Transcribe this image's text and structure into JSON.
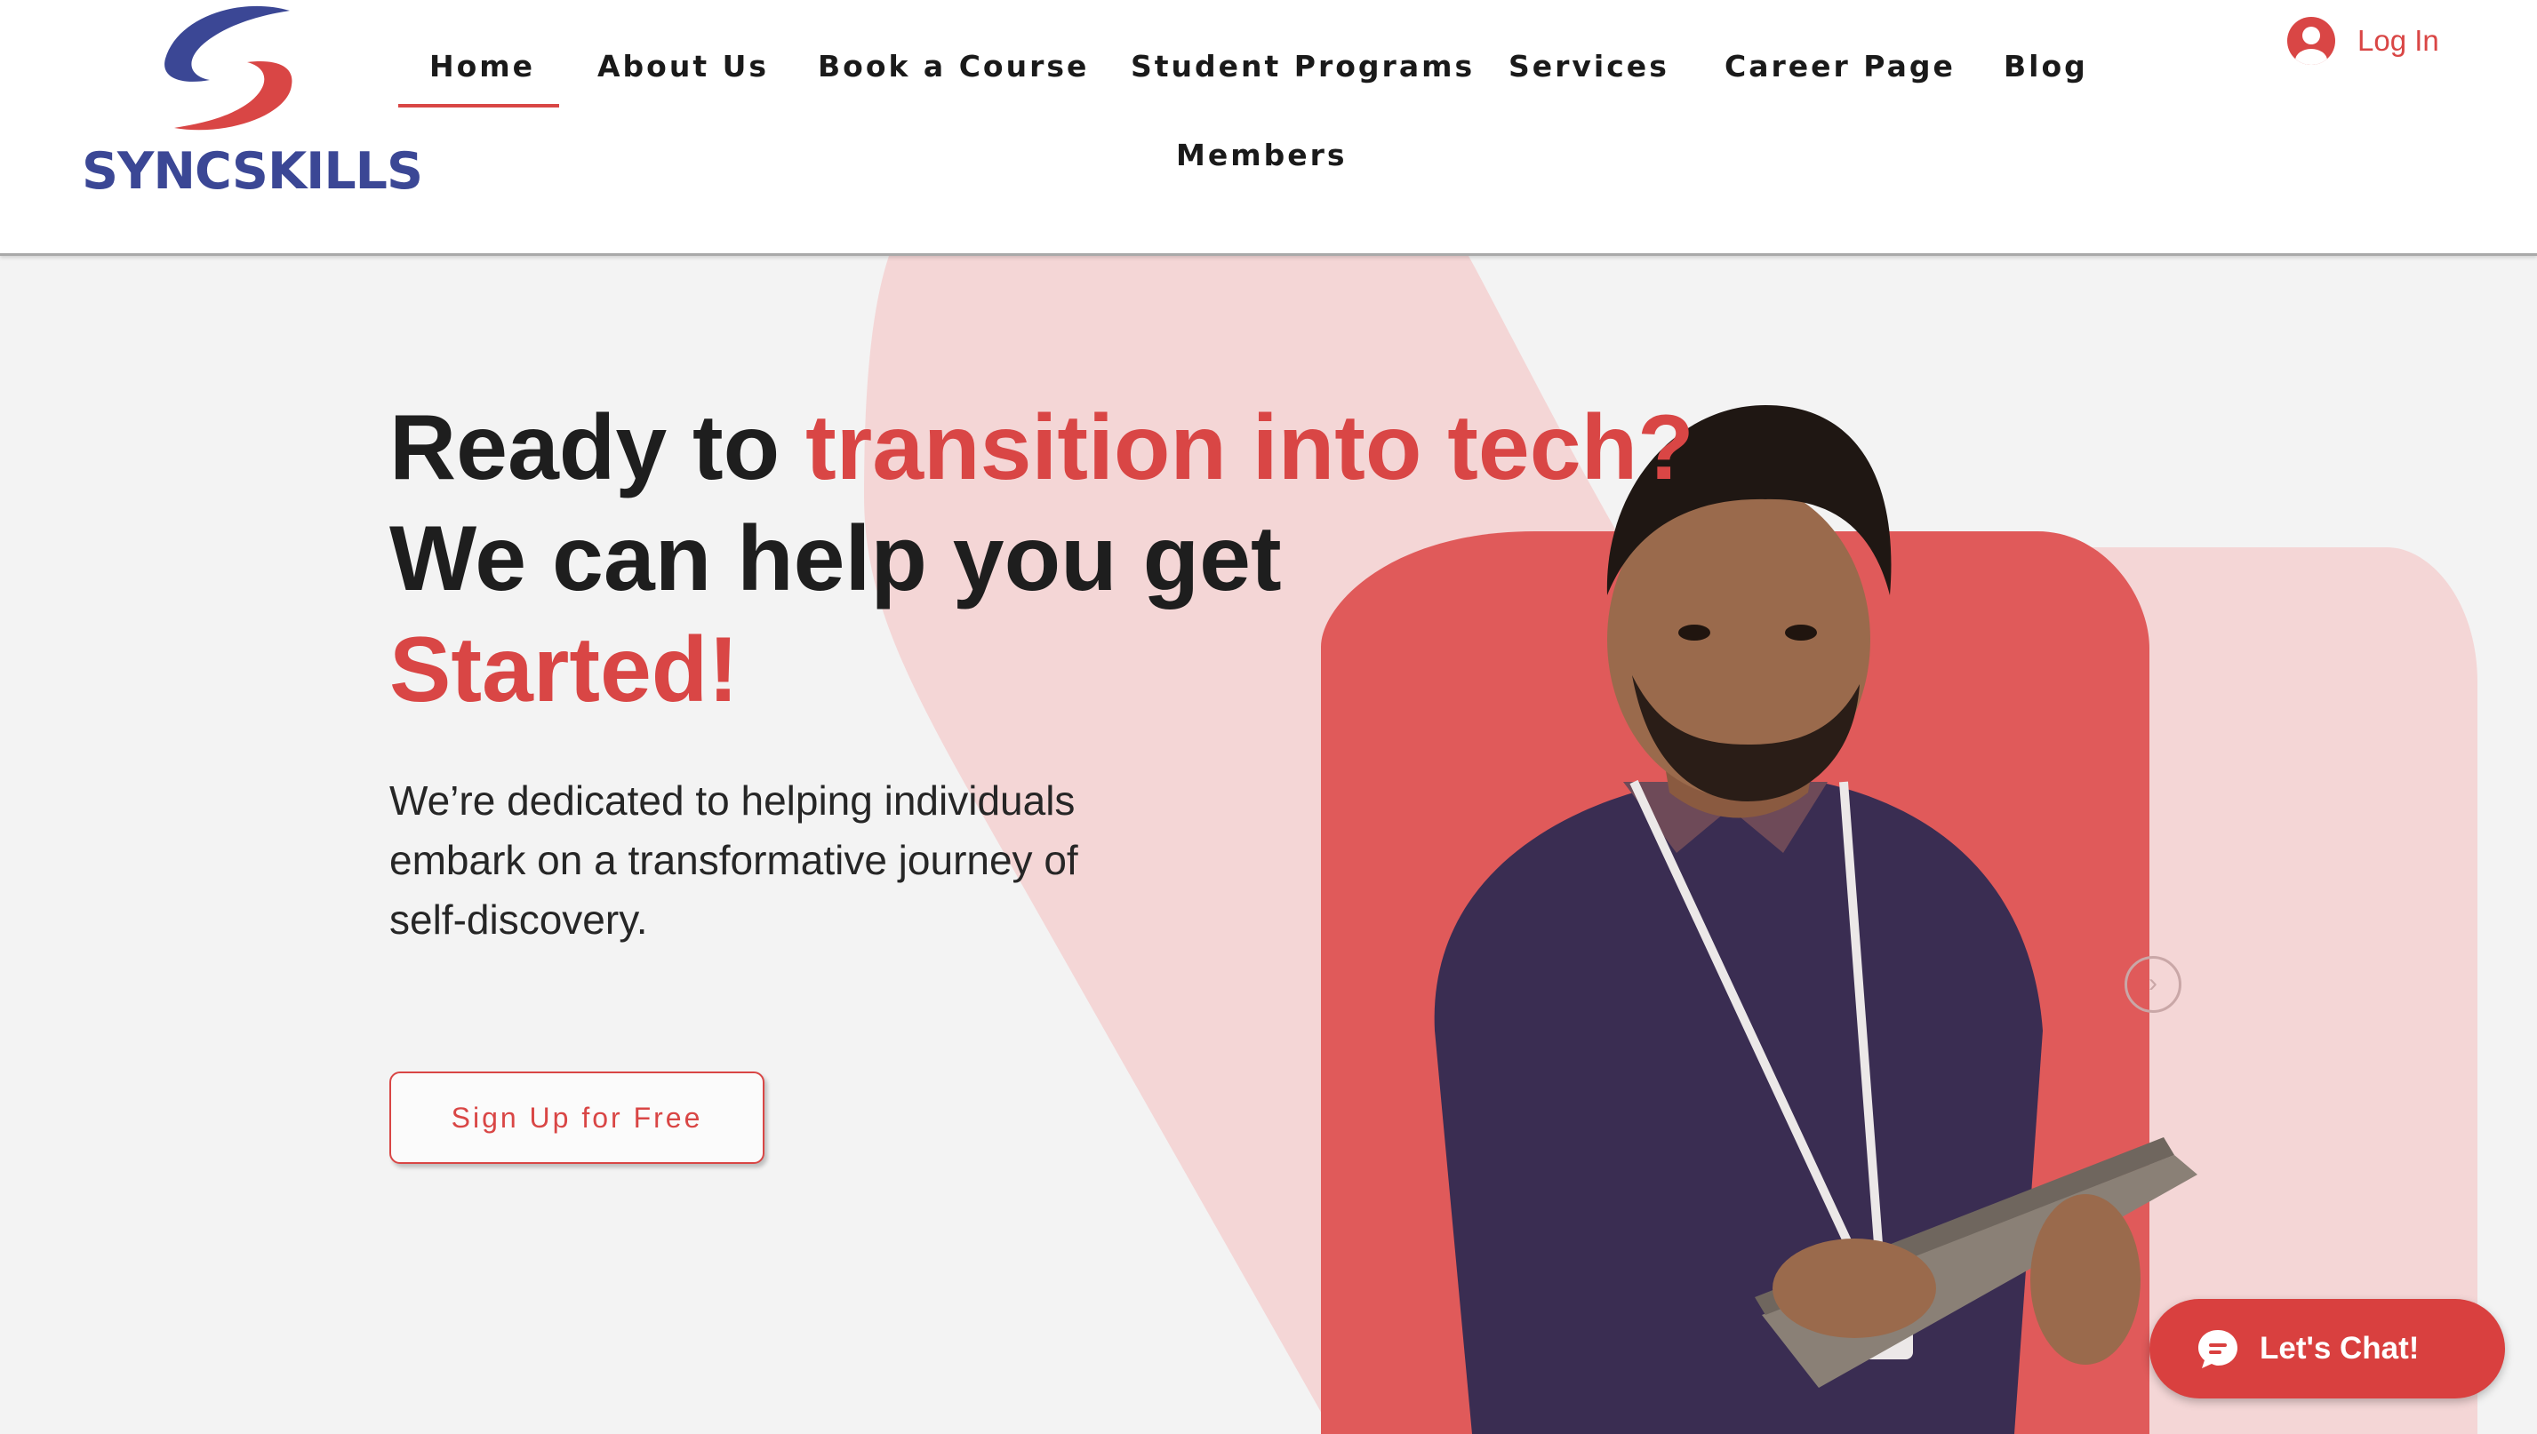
{
  "brand": {
    "name": "SYNCSKILLS",
    "colors": {
      "accent": "#d94645",
      "navy": "#3b4795",
      "pink": "#f4d6d6"
    }
  },
  "nav": {
    "items": [
      {
        "label": "Home",
        "active": true
      },
      {
        "label": "About Us"
      },
      {
        "label": "Book a Course"
      },
      {
        "label": "Student Programs"
      },
      {
        "label": "Services"
      },
      {
        "label": "Career Page"
      },
      {
        "label": "Blog"
      },
      {
        "label": "Members"
      }
    ],
    "login_label": "Log In",
    "login_icon": "user-avatar-icon"
  },
  "hero": {
    "headline": {
      "part1": "Ready to ",
      "highlight1": "transition into tech?",
      "line2": "We can help you get",
      "highlight2": "Started!"
    },
    "subtext": "We’re dedicated to helping individuals embark on a transformative journey of self-discovery.",
    "cta_label": "Sign Up for Free",
    "slider_arrow": "›"
  },
  "chat": {
    "label": "Let's Chat!",
    "icon": "chat-bubble-icon"
  }
}
